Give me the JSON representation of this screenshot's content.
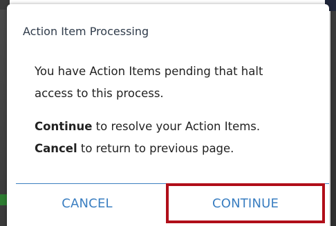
{
  "dialog": {
    "title": "Action Item Processing",
    "message_line1": "You have Action Items pending that halt",
    "message_line2": "access to this process.",
    "continue_bold": "Continue",
    "continue_rest": " to resolve your Action Items.",
    "cancel_bold": "Cancel",
    "cancel_rest": " to return to previous page."
  },
  "buttons": {
    "cancel_label": "CANCEL",
    "continue_label": "CONTINUE"
  },
  "colors": {
    "accent": "#3a7ec1",
    "highlight": "#b00e19",
    "title_text": "#2f3b4a"
  }
}
